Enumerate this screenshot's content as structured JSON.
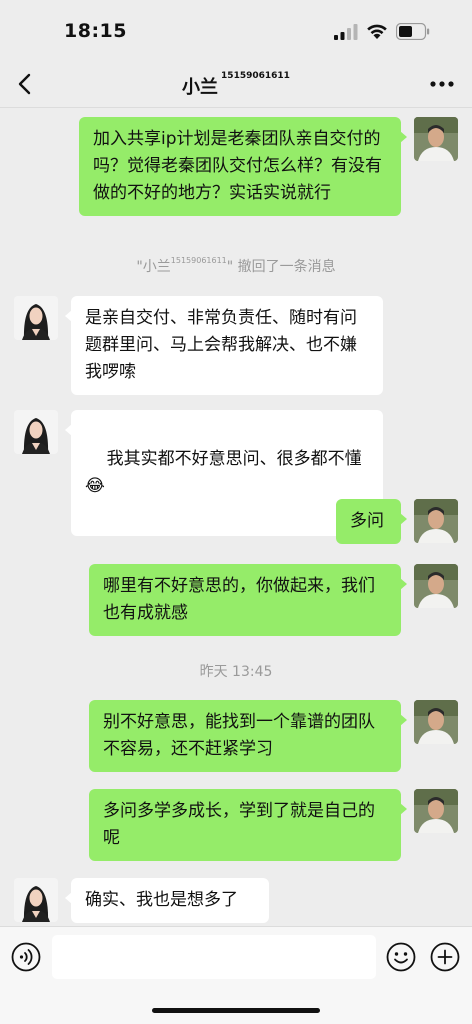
{
  "status_bar": {
    "time": "18:15"
  },
  "header": {
    "contact_name": "小兰",
    "contact_phone": "15159061611"
  },
  "messages": [
    {
      "id": "m1",
      "direction": "out",
      "text": "加入共享ip计划是老秦团队亲自交付的吗？觉得老秦团队交付怎么样？有没有做的不好的地方？实话实说就行"
    },
    {
      "id": "s1",
      "type": "system",
      "quote_open": "\"小兰",
      "phone": "15159061611",
      "suffix": "\" 撤回了一条消息"
    },
    {
      "id": "m2",
      "direction": "in",
      "text": "是亲自交付、非常负责任、随时有问题群里问、马上会帮我解决、也不嫌我啰嗦"
    },
    {
      "id": "m3",
      "direction": "in",
      "text": "我其实都不好意思问、很多都不懂",
      "emoji": "😂"
    },
    {
      "id": "m4",
      "direction": "out",
      "text": "多问"
    },
    {
      "id": "m5",
      "direction": "out",
      "text": "哪里有不好意思的，你做起来，我们也有成就感"
    },
    {
      "id": "t1",
      "type": "timestamp",
      "text": "昨天 13:45"
    },
    {
      "id": "m6",
      "direction": "out",
      "text": "别不好意思，能找到一个靠谱的团队不容易，还不赶紧学习"
    },
    {
      "id": "m7",
      "direction": "out",
      "text": "多问多学多成长，学到了就是自己的呢"
    },
    {
      "id": "m8",
      "direction": "in",
      "text": "确实、我也是想多了"
    }
  ],
  "input": {
    "placeholder": ""
  },
  "icons": {
    "back": "chevron-left-icon",
    "more": "more-horizontal-icon",
    "voice": "voice-icon",
    "emoji": "emoji-icon",
    "plus": "plus-icon"
  },
  "colors": {
    "background": "#ededed",
    "outgoing_bubble": "#95ec69",
    "incoming_bubble": "#ffffff",
    "system_text": "#9a9a9a"
  }
}
